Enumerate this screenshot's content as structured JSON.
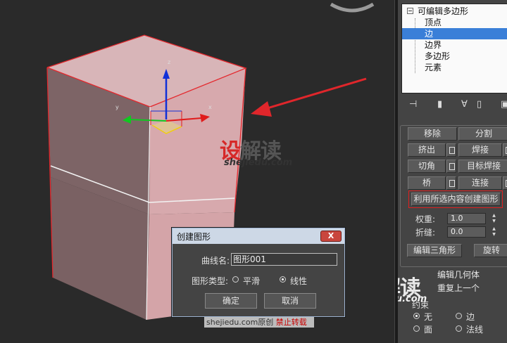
{
  "modifier_stack": {
    "root": "可编辑多边形",
    "items": [
      "顶点",
      "边",
      "边界",
      "多边形",
      "元素"
    ],
    "selected": "边"
  },
  "edit_edges": {
    "buttons": [
      {
        "left": "移除",
        "right": "分割"
      },
      {
        "left": "挤出",
        "right": "焊接"
      },
      {
        "left": "切角",
        "right": "目标焊接"
      },
      {
        "left": "桥",
        "right": "连接"
      }
    ],
    "create_shape_label": "利用所选内容创建图形",
    "weight_label": "权重:",
    "weight_value": "1.0",
    "crease_label": "折缝:",
    "crease_value": "0.0",
    "edit_tri_label": "编辑三角形",
    "turn_label": "旋转"
  },
  "edit_geometry": {
    "title": "编辑几何体",
    "repeat_last": "重复上一个",
    "constraints_label": "约束",
    "constraint_options": [
      "无",
      "边",
      "面",
      "法线"
    ],
    "selected_constraint": "无"
  },
  "dialog": {
    "title": "创建图形",
    "close_label": "X",
    "curve_name_label": "曲线名:",
    "curve_name_value": "图形001",
    "shape_type_label": "图形类型:",
    "shape_types": [
      "平滑",
      "线性"
    ],
    "selected_shape_type": "线性",
    "ok_label": "确定",
    "cancel_label": "取消"
  },
  "viewport": {
    "axis_labels": {
      "x": "x",
      "y": "y",
      "z": "z"
    }
  },
  "watermark": {
    "logo_red": "设",
    "logo_rest": "解读",
    "url": "shejiedu.com",
    "banner_text": "shejiedu.com原创",
    "banner_red": "禁止转载"
  },
  "colors": {
    "selection_highlight": "#3a7fd8",
    "edge_highlight": "#e02020",
    "box_face": "#d8a8ac"
  }
}
